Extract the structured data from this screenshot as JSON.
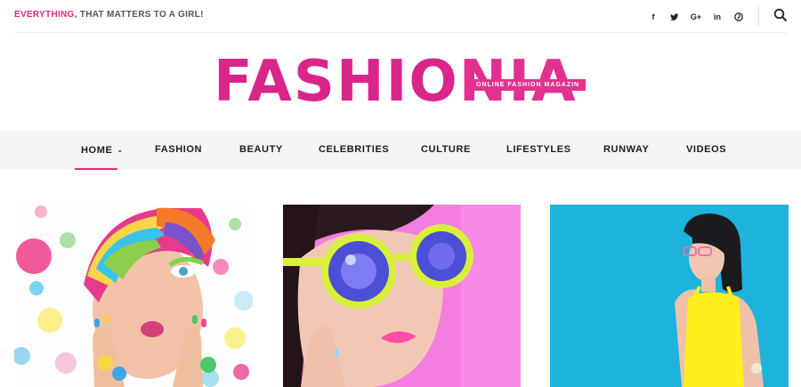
{
  "topbar": {
    "tagline_accent": "EVERYTHING",
    "tagline_rest": ", THAT MATTERS TO A GIRL!",
    "social": [
      {
        "icon": "facebook-icon",
        "glyph": "f"
      },
      {
        "icon": "twitter-icon",
        "glyph": "t"
      },
      {
        "icon": "google-plus-icon",
        "glyph": "G+"
      },
      {
        "icon": "linkedin-icon",
        "glyph": "in"
      },
      {
        "icon": "pinterest-icon",
        "glyph": "p"
      }
    ],
    "search_icon": "search-icon"
  },
  "logo": {
    "main": "FASHIO",
    "tail": "NIA",
    "badge": "ONLINE FASHION MAGAZIN"
  },
  "nav": {
    "items": [
      {
        "label": "HOME",
        "active": true,
        "has_dropdown": true
      },
      {
        "label": "FASHION"
      },
      {
        "label": "BEAUTY"
      },
      {
        "label": "CELEBRITIES"
      },
      {
        "label": "CULTURE"
      },
      {
        "label": "LIFESTYLES"
      },
      {
        "label": "RUNWAY"
      },
      {
        "label": "VIDEOS"
      }
    ]
  },
  "cards": [
    {
      "image": "rainbow-hair-woman-photo",
      "bg": "#ffffff"
    },
    {
      "image": "yellow-sunglasses-woman-photo",
      "bg": "#f47ee0"
    },
    {
      "image": "yellow-top-woman-photo",
      "bg": "#1eb3dc"
    }
  ],
  "colors": {
    "accent": "#e4287c",
    "nav_bg": "#f5f5f5"
  }
}
